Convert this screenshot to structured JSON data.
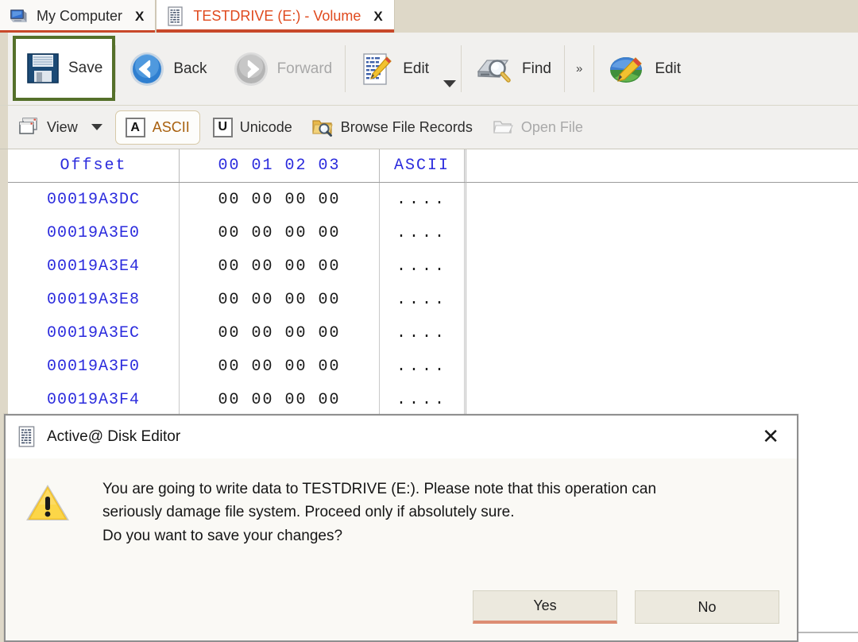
{
  "window": {
    "app_title": "Active@ Disk Editor"
  },
  "tabs": [
    {
      "label": "My Computer",
      "icon": "computer-icon",
      "close": "X",
      "active": false
    },
    {
      "label": "TESTDRIVE (E:) - Volume",
      "icon": "hex-document-icon",
      "close": "X",
      "active": true
    }
  ],
  "toolbar_primary": [
    {
      "label": "Save",
      "icon": "floppy-save-icon",
      "disabled": false,
      "highlighted": true,
      "dropdown": false
    },
    {
      "label": "Back",
      "icon": "back-arrow-icon",
      "disabled": false,
      "highlighted": false,
      "dropdown": false
    },
    {
      "label": "Forward",
      "icon": "forward-arrow-icon",
      "disabled": true,
      "highlighted": false,
      "dropdown": false
    },
    {
      "label": "Edit",
      "icon": "edit-document-icon",
      "disabled": false,
      "highlighted": false,
      "dropdown": true
    },
    {
      "label": "Find",
      "icon": "find-disk-icon",
      "disabled": false,
      "highlighted": false,
      "dropdown": false
    },
    {
      "label": "Edit",
      "icon": "edit-volume-icon",
      "disabled": false,
      "highlighted": false,
      "dropdown": false
    }
  ],
  "toolbar_overflow_label": "»",
  "toolbar_secondary": [
    {
      "label": "View",
      "icon": "view-windows-icon",
      "disabled": false,
      "selected": false,
      "dropdown": true
    },
    {
      "label": "ASCII",
      "icon": "letter-a-icon",
      "disabled": false,
      "selected": true,
      "dropdown": false
    },
    {
      "label": "Unicode",
      "icon": "letter-u-icon",
      "disabled": false,
      "selected": false,
      "dropdown": false
    },
    {
      "label": "Browse File Records",
      "icon": "folder-search-icon",
      "disabled": false,
      "selected": false,
      "dropdown": false
    },
    {
      "label": "Open File",
      "icon": "open-file-icon",
      "disabled": true,
      "selected": false,
      "dropdown": false
    }
  ],
  "hex_view": {
    "headers": {
      "offset": "Offset",
      "bytes": "00 01 02 03",
      "ascii": "ASCII"
    },
    "rows": [
      {
        "offset": "00019A3DC",
        "bytes": "00 00 00 00",
        "ascii": "...."
      },
      {
        "offset": "00019A3E0",
        "bytes": "00 00 00 00",
        "ascii": "...."
      },
      {
        "offset": "00019A3E4",
        "bytes": "00 00 00 00",
        "ascii": "...."
      },
      {
        "offset": "00019A3E8",
        "bytes": "00 00 00 00",
        "ascii": "...."
      },
      {
        "offset": "00019A3EC",
        "bytes": "00 00 00 00",
        "ascii": "...."
      },
      {
        "offset": "00019A3F0",
        "bytes": "00 00 00 00",
        "ascii": "...."
      },
      {
        "offset": "00019A3F4",
        "bytes": "00 00 00 00",
        "ascii": "...."
      }
    ]
  },
  "dialog": {
    "title": "Active@ Disk Editor",
    "icon": "hex-document-icon",
    "close_label": "✕",
    "warning_icon": "warning-triangle-icon",
    "message_line1": "You are going to write data to TESTDRIVE (E:). Please note that this operation can",
    "message_line2": "seriously damage file system. Proceed only if absolutely sure.",
    "message_line3": "Do you want to save your changes?",
    "buttons": [
      {
        "label": "Yes",
        "default": true
      },
      {
        "label": "No",
        "default": false
      }
    ]
  },
  "colors": {
    "tab_active_text": "#e04a1e",
    "tab_underline": "#c8482a",
    "save_highlight_border": "#55702a",
    "hex_offset_text": "#2b2bdd",
    "selected_toolbar_text": "#a8600e",
    "default_button_underline": "#dd8d73",
    "chrome_beige": "#ded8c8"
  }
}
